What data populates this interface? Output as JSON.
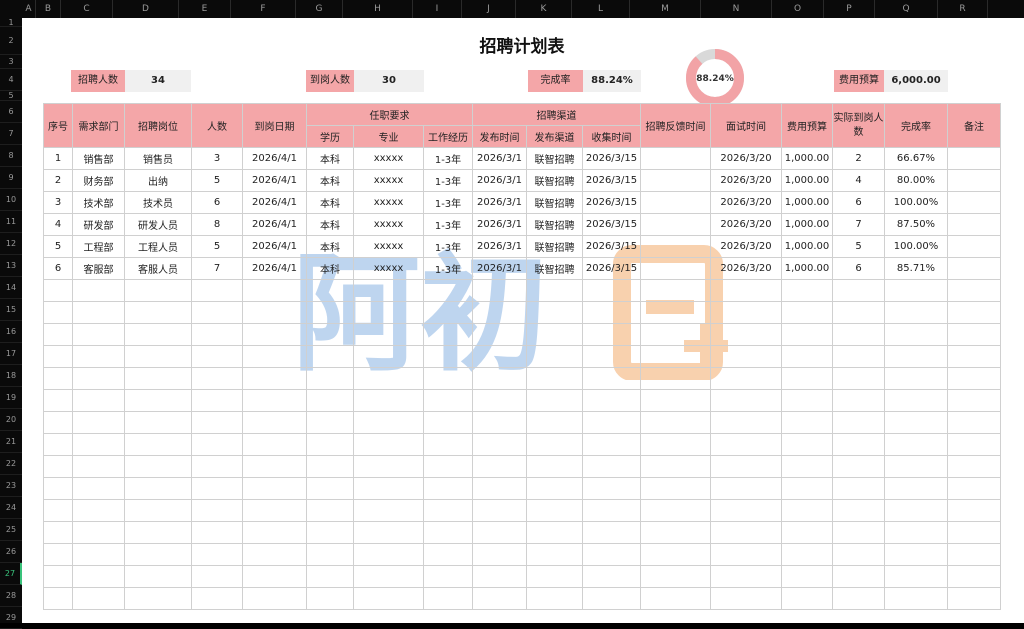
{
  "columns": [
    "A",
    "B",
    "C",
    "D",
    "E",
    "F",
    "G",
    "H",
    "I",
    "J",
    "K",
    "L",
    "M",
    "N",
    "O",
    "P",
    "Q",
    "R"
  ],
  "rows": [
    "1",
    "2",
    "3",
    "4",
    "5",
    "6",
    "7",
    "8",
    "9",
    "10",
    "11",
    "12",
    "13",
    "14",
    "15",
    "16",
    "17",
    "18",
    "19",
    "20",
    "21",
    "22",
    "23",
    "24",
    "25",
    "26",
    "27",
    "28",
    "29"
  ],
  "selected_row": "27",
  "title": "招聘计划表",
  "stats": {
    "recruit_label": "招聘人数",
    "recruit_value": "34",
    "arrived_label": "到岗人数",
    "arrived_value": "30",
    "rate_label": "完成率",
    "rate_value": "88.24%",
    "budget_label": "费用预算",
    "budget_value": "6,000.00"
  },
  "donut": {
    "label": "88.24%",
    "fraction": 0.8824,
    "fill_color": "#f2a3a6",
    "rest_color": "#d9d9d9"
  },
  "watermark": {
    "text": "阿初",
    "colors": [
      "#a9c7ea",
      "#f7c9a0"
    ]
  },
  "header": {
    "seq": "序号",
    "dept": "需求部门",
    "post": "招聘岗位",
    "count": "人数",
    "arrive_date": "到岗日期",
    "req_group": "任职要求",
    "edu": "学历",
    "major": "专业",
    "exp": "工作经历",
    "channel_group": "招聘渠道",
    "pub_time": "发布时间",
    "channel": "发布渠道",
    "collect_time": "收集时间",
    "feedback_time": "招聘反馈时间",
    "interview_time": "面试时间",
    "budget": "费用预算",
    "actual": "实际到岗人数",
    "rate": "完成率",
    "note": "备注"
  },
  "records": [
    [
      "1",
      "销售部",
      "销售员",
      "3",
      "2026/4/1",
      "本科",
      "xxxxx",
      "1-3年",
      "2026/3/1",
      "联智招聘",
      "2026/3/15",
      "",
      "2026/3/20",
      "1,000.00",
      "2",
      "66.67%",
      ""
    ],
    [
      "2",
      "财务部",
      "出纳",
      "5",
      "2026/4/1",
      "本科",
      "xxxxx",
      "1-3年",
      "2026/3/1",
      "联智招聘",
      "2026/3/15",
      "",
      "2026/3/20",
      "1,000.00",
      "4",
      "80.00%",
      ""
    ],
    [
      "3",
      "技术部",
      "技术员",
      "6",
      "2026/4/1",
      "本科",
      "xxxxx",
      "1-3年",
      "2026/3/1",
      "联智招聘",
      "2026/3/15",
      "",
      "2026/3/20",
      "1,000.00",
      "6",
      "100.00%",
      ""
    ],
    [
      "4",
      "研发部",
      "研发人员",
      "8",
      "2026/4/1",
      "本科",
      "xxxxx",
      "1-3年",
      "2026/3/1",
      "联智招聘",
      "2026/3/15",
      "",
      "2026/3/20",
      "1,000.00",
      "7",
      "87.50%",
      ""
    ],
    [
      "5",
      "工程部",
      "工程人员",
      "5",
      "2026/4/1",
      "本科",
      "xxxxx",
      "1-3年",
      "2026/3/1",
      "联智招聘",
      "2026/3/15",
      "",
      "2026/3/20",
      "1,000.00",
      "5",
      "100.00%",
      ""
    ],
    [
      "6",
      "客服部",
      "客服人员",
      "7",
      "2026/4/1",
      "本科",
      "xxxxx",
      "1-3年",
      "2026/3/1",
      "联智招聘",
      "2026/3/15",
      "",
      "2026/3/20",
      "1,000.00",
      "6",
      "85.71%",
      ""
    ]
  ],
  "empty_rows": 15
}
